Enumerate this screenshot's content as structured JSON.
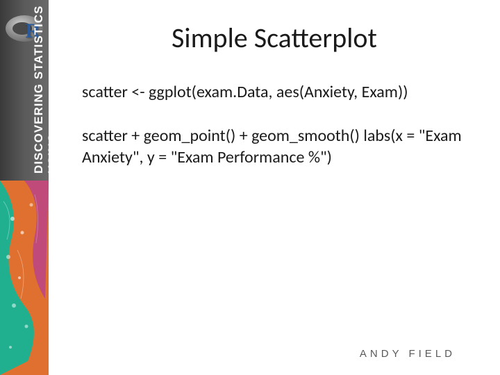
{
  "sidebar": {
    "vertical_text_line1": "DISCOVERING STATISTICS",
    "vertical_text_line2": "USING",
    "logo_letter": "R"
  },
  "slide": {
    "title": "Simple Scatterplot",
    "paragraph1": "scatter <- ggplot(exam.Data, aes(Anxiety, Exam))",
    "paragraph2": "scatter + geom_point() + geom_smooth() labs(x = \"Exam Anxiety\", y = \"Exam Performance %\")"
  },
  "footer": {
    "author": "ANDY FIELD"
  }
}
